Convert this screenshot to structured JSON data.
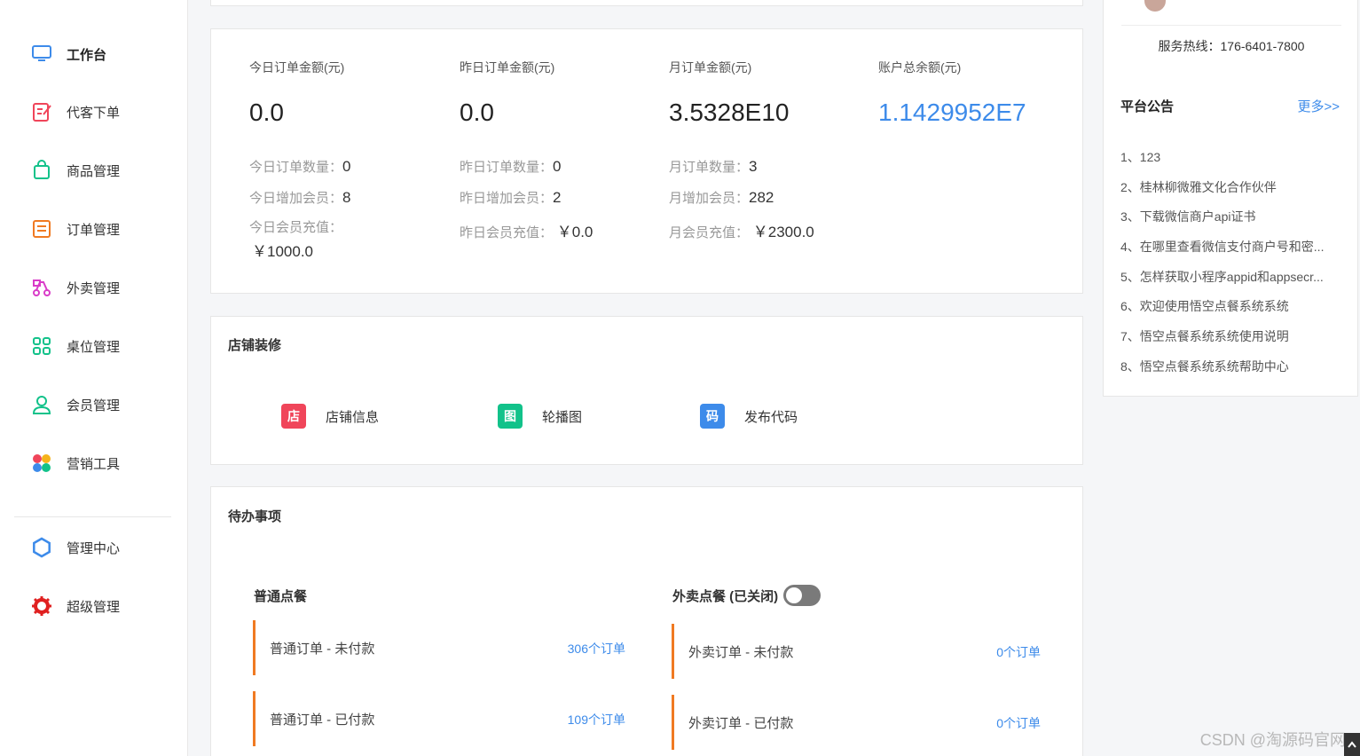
{
  "sidebar": {
    "items": [
      {
        "label": "工作台",
        "icon": "monitor-icon",
        "color": "#3d8bea"
      },
      {
        "label": "代客下单",
        "icon": "edit-order-icon",
        "color": "#f0455a"
      },
      {
        "label": "商品管理",
        "icon": "bag-icon",
        "color": "#12c28a"
      },
      {
        "label": "订单管理",
        "icon": "order-list-icon",
        "color": "#f07a22"
      },
      {
        "label": "外卖管理",
        "icon": "scooter-icon",
        "color": "#d93cc8"
      },
      {
        "label": "桌位管理",
        "icon": "grid-icon",
        "color": "#12c28a"
      },
      {
        "label": "会员管理",
        "icon": "user-icon",
        "color": "#12c28a"
      },
      {
        "label": "营销工具",
        "icon": "flower-icon",
        "color": "#f0455a"
      },
      {
        "label": "管理中心",
        "icon": "gear-icon",
        "color": "#3d8bea"
      },
      {
        "label": "超级管理",
        "icon": "cog-icon",
        "color": "#e02020"
      }
    ]
  },
  "stats": {
    "today": {
      "title": "今日订单金额(元)",
      "value": "0.0",
      "count_key": "今日订单数量：",
      "count": "0",
      "members_key": "今日增加会员：",
      "members": "8",
      "recharge_key": "今日会员充值：",
      "recharge": "￥1000.0"
    },
    "yesterday": {
      "title": "昨日订单金额(元)",
      "value": "0.0",
      "count_key": "昨日订单数量：",
      "count": "0",
      "members_key": "昨日增加会员：",
      "members": "2",
      "recharge_key": "昨日会员充值：",
      "recharge": "￥0.0"
    },
    "month": {
      "title": "月订单金额(元)",
      "value": "3.5328E10",
      "count_key": "月订单数量：",
      "count": "3",
      "members_key": "月增加会员：",
      "members": "282",
      "recharge_key": "月会员充值：",
      "recharge": "￥2300.0"
    },
    "balance": {
      "title": "账户总余额(元)",
      "value": "1.1429952E7"
    }
  },
  "decor": {
    "title": "店铺装修",
    "items": [
      {
        "badge": "店",
        "label": "店铺信息",
        "color": "#f0455a"
      },
      {
        "badge": "图",
        "label": "轮播图",
        "color": "#12c28a"
      },
      {
        "badge": "码",
        "label": "发布代码",
        "color": "#3d8bea"
      }
    ]
  },
  "todo": {
    "title": "待办事项",
    "dine_in": {
      "title": "普通点餐",
      "rows": [
        {
          "label": "普通订单 - 未付款",
          "count": "306个订单"
        },
        {
          "label": "普通订单 - 已付款",
          "count": "109个订单"
        }
      ]
    },
    "delivery": {
      "title": "外卖点餐 (已关闭)",
      "toggle_on": false,
      "rows": [
        {
          "label": "外卖订单 - 未付款",
          "count": "0个订单"
        },
        {
          "label": "外卖订单 - 已付款",
          "count": "0个订单"
        }
      ]
    }
  },
  "right": {
    "hotline": "服务热线：176-6401-7800",
    "notice_title": "平台公告",
    "more_label": "更多>>",
    "notices": [
      "1、123",
      "2、桂林柳微雅文化合作伙伴",
      "3、下载微信商户api证书",
      "4、在哪里查看微信支付商户号和密...",
      "5、怎样获取小程序appid和appsecr...",
      "6、欢迎使用悟空点餐系统系统",
      "7、悟空点餐系统系统使用说明",
      "8、悟空点餐系统系统帮助中心"
    ]
  },
  "watermark": "CSDN @淘源码官网",
  "colors": {
    "accent": "#3d8bea",
    "orange": "#f07a22"
  }
}
